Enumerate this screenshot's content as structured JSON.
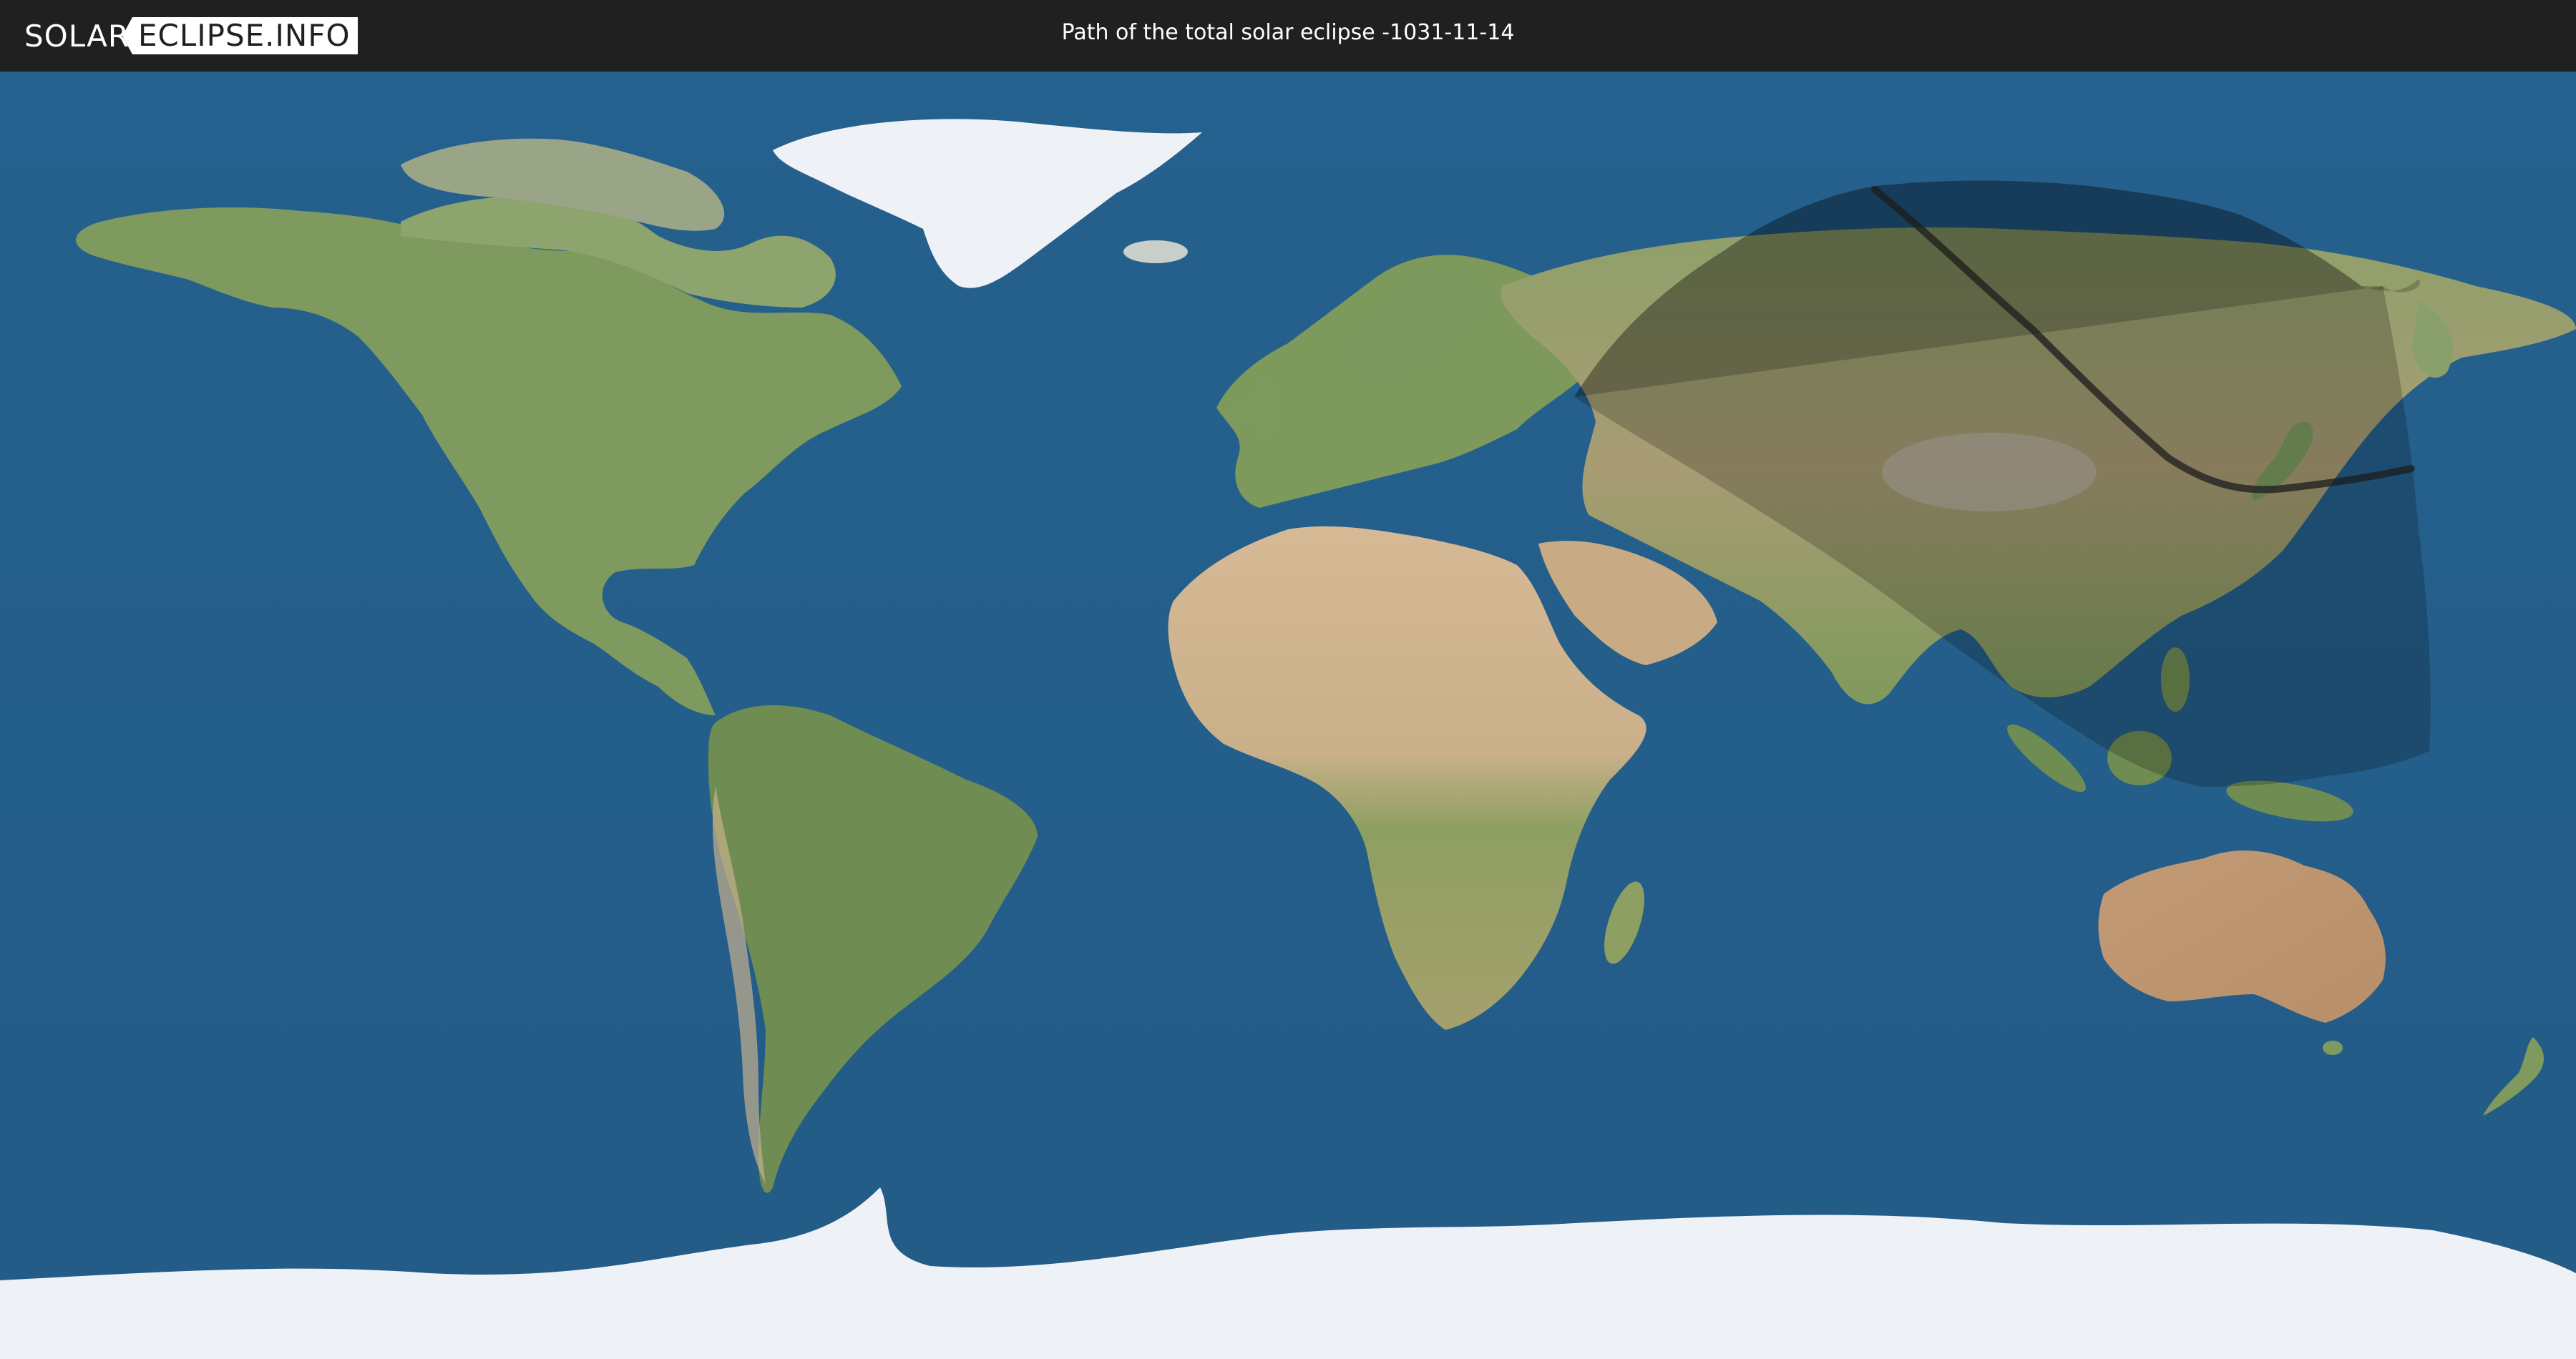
{
  "header": {
    "logo_left": "SOLAR",
    "logo_right": "ECLIPSE.INFO",
    "title": "Path of the total solar eclipse -1031-11-14"
  },
  "colors": {
    "header_bg": "#202020",
    "ocean": "#255f8c",
    "land": "#7f9a5c",
    "desert": "#c8ad86",
    "ice": "#eef2f6",
    "penumbra": "#000000",
    "path": "#1c1c1c"
  },
  "map": {
    "projection": "equirectangular",
    "eclipse_type": "total"
  }
}
